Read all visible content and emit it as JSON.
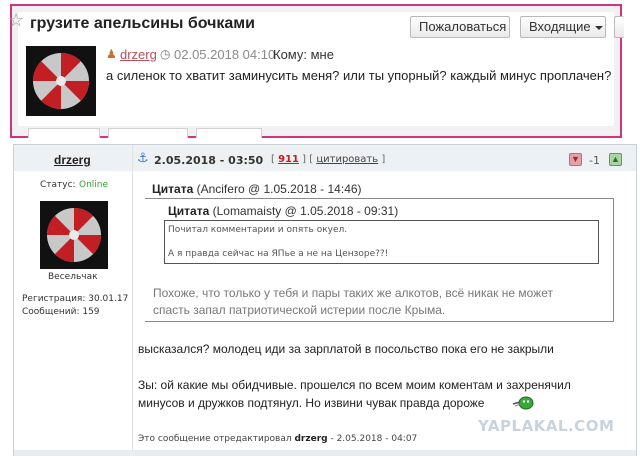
{
  "message": {
    "title": "грузите апельсины бочками",
    "report_label": "Пожаловаться",
    "incoming_label": "Входящие",
    "sender": "drzerg",
    "date": "02.05.2018 04:10",
    "recipient_label": "Кому: мне",
    "body": "а силенок то хватит заминусить меня? или ты упорный? каждый минус проплачен?"
  },
  "post": {
    "author": "drzerg",
    "status_label": "Статус:",
    "status_value": "Online",
    "rank": "Весельчак",
    "registration": "Регистрация: 30.01.17",
    "messages": "Сообщений: 159",
    "date": "2.05.2018 - 03:50",
    "number": "911",
    "cite_label": "цитировать",
    "score": "-1",
    "quote_outer_author": "Цитата",
    "quote_outer_meta": "(Ancifero @ 1.05.2018 - 14:46)",
    "quote_inner_author": "Цитата",
    "quote_inner_meta": "(Lomamaisty @ 1.05.2018 - 09:31)",
    "quote_inner_line1": "Почитал комментарии и опять окуел.",
    "quote_inner_line2": "А я правда сейчас на ЯПье а не на Цензоре??!",
    "quote_outer_line1": "Похоже, что только у тебя и пары таких же алкотов, всё никак не может",
    "quote_outer_line2": "спасть запал патриотической истерии после Крыма.",
    "reply_line1": "высказался? молодец иди за зарплатой в посольство пока его не закрыли",
    "reply_line2": "Зы: ой какие мы обидчивые. прошелся по всем моим коментам и захренячил",
    "reply_line3": "минусов и дружков подтянул. Но извини чувак правда дороже",
    "edit_prefix": "Это сообщение отредактировал",
    "edit_user": "drzerg",
    "edit_date": "- 2.05.2018 - 04:07"
  },
  "watermark": "YAPLAKAL.COM",
  "colors": {
    "popup_border": "#d5337f",
    "online": "#2fa52f",
    "post_number": "#c21d1d"
  },
  "icons": {
    "favorite": "star-icon",
    "sender": "user-icon",
    "time": "clock-icon",
    "permalink": "anchor-icon",
    "vote_down": "thumb-down-icon",
    "vote_up": "thumb-up-icon",
    "avatar": "umbrella-logo"
  }
}
